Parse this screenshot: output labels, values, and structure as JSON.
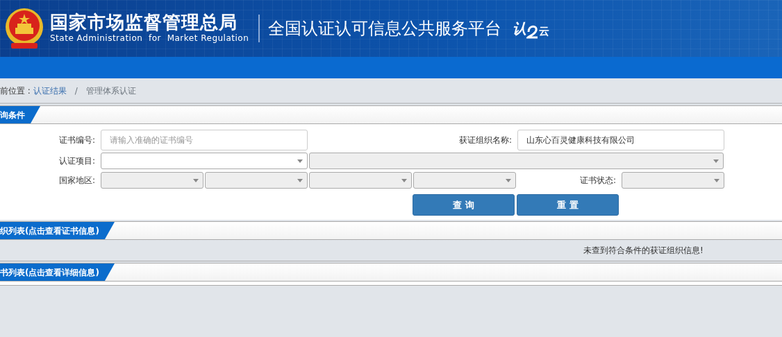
{
  "header": {
    "title": "国家市场监督管理总局",
    "subtitle": "State Administration  for  Market Regulation",
    "platform": "全国认证认可信息公共服务平台",
    "logo_left": "认",
    "logo_right": "云"
  },
  "breadcrumb": {
    "label": "前位置 :",
    "separator": "/",
    "items": [
      {
        "text": "认证结果",
        "link": true
      },
      {
        "text": "管理体系认证",
        "link": false
      }
    ]
  },
  "query": {
    "title": "询条件",
    "rows": [
      [
        {
          "label": "证书编号:",
          "kind": "input",
          "placeholder": "请输入准确的证书编号"
        },
        {
          "label": "获证组织名称:",
          "kind": "input",
          "value": "山东心百灵健康科技有限公司"
        }
      ],
      [
        {
          "label": "认证项目:",
          "kind": "select",
          "disabled": false
        },
        {
          "kind": "select",
          "disabled": true
        }
      ],
      [
        {
          "label": "国家地区:",
          "kind": "select",
          "disabled": true
        },
        {
          "kind": "select",
          "disabled": true
        },
        {
          "kind": "select",
          "disabled": true
        },
        {
          "kind": "select",
          "disabled": true
        },
        {
          "label": "证书状态:",
          "kind": "select",
          "disabled": true
        }
      ]
    ],
    "buttons": [
      "查 询",
      "重 置"
    ]
  },
  "org_list": {
    "title": "织列表(点击查看证书信息)",
    "message": "未查到符合条件的获证组织信息!"
  },
  "cert_list": {
    "title": "书列表(点击查看详细信息)"
  }
}
